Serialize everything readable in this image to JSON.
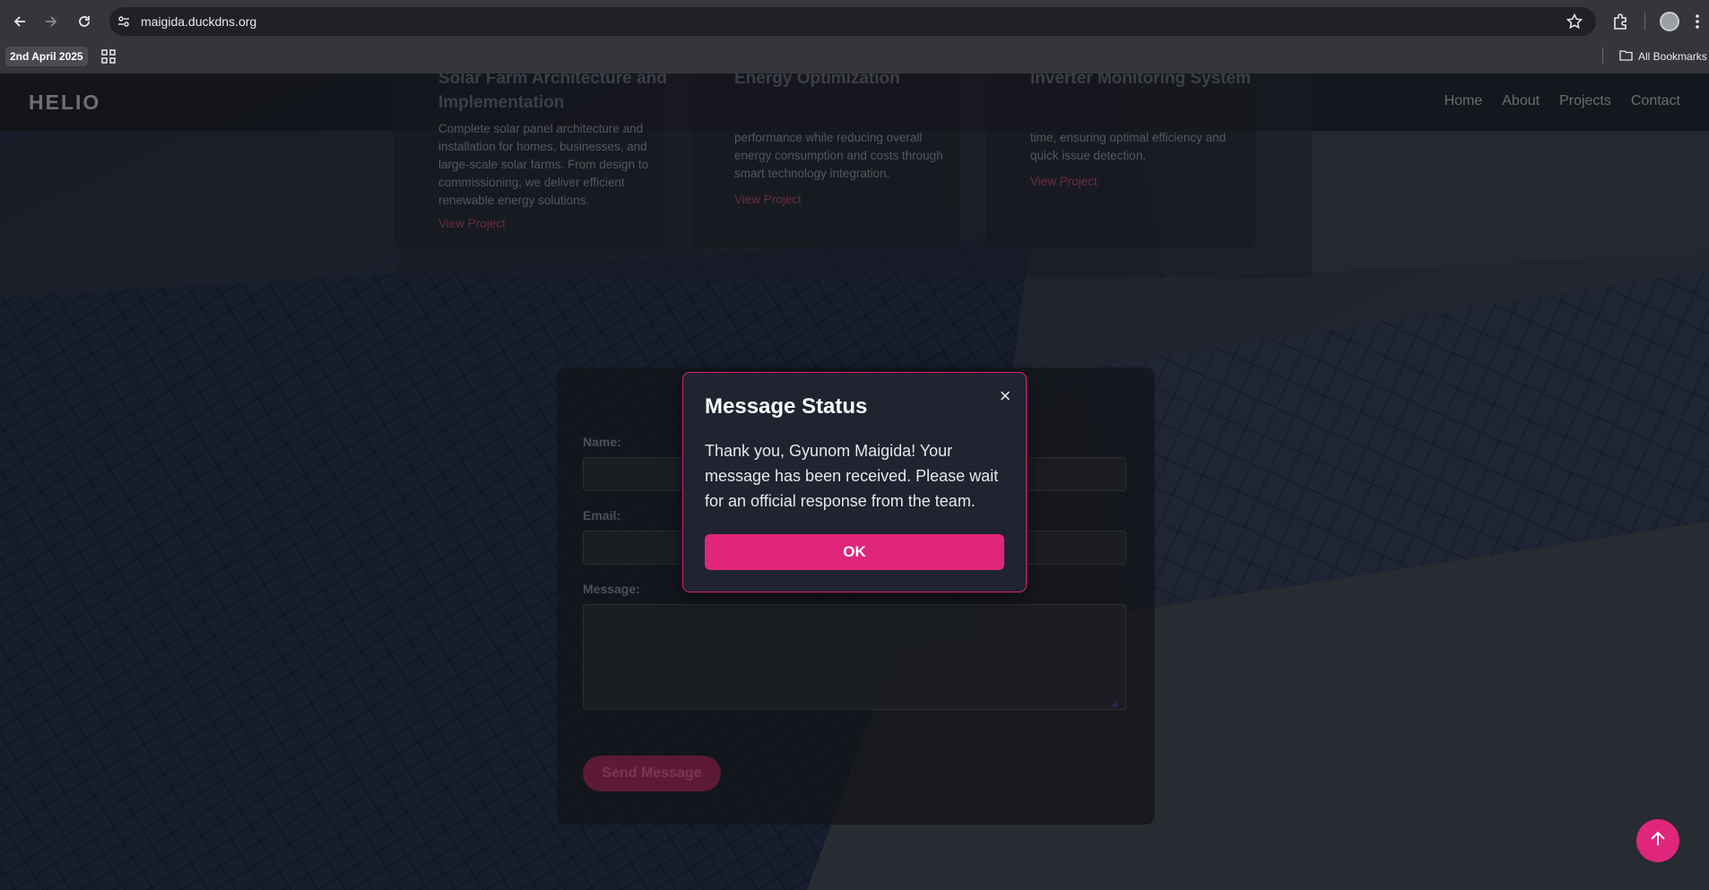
{
  "browser": {
    "url": "maigida.duckdns.org",
    "bookmark_date": "2nd April 2025",
    "all_bookmarks": "All Bookmarks"
  },
  "site": {
    "logo": "HELIO",
    "nav": [
      "Home",
      "About",
      "Projects",
      "Contact"
    ]
  },
  "projects": [
    {
      "title": "Solar Farm Architecture and Implementation",
      "description": "Complete solar panel architecture and installation for homes, businesses, and large-scale solar farms. From design to commissioning, we deliver efficient renewable energy solutions.",
      "link": "View Project"
    },
    {
      "title": "Energy Optimization",
      "description": "performance while reducing overall energy consumption and costs through smart technology integration.",
      "link": "View Project"
    },
    {
      "title": "Inverter Monitoring System",
      "description": "time, ensuring optimal efficiency and quick issue detection.",
      "link": "View Project"
    }
  ],
  "contact_form": {
    "name_label": "Name:",
    "email_label": "Email:",
    "message_label": "Message:",
    "send_button": "Send Message"
  },
  "modal": {
    "title": "Message Status",
    "close": "×",
    "body": "Thank you, Gyunom Maigida! Your message has been received. Please wait for an official response from the team.",
    "ok_button": "OK"
  },
  "colors": {
    "accent": "#e0267a",
    "modal_bg": "#1f2430"
  }
}
